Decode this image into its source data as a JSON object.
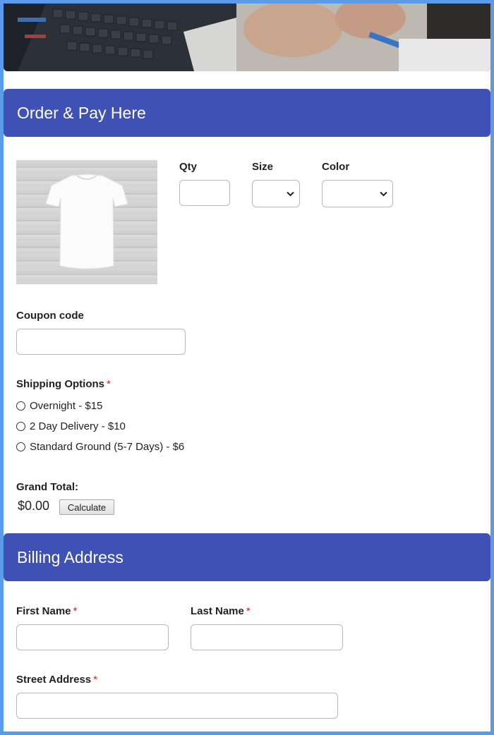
{
  "order_section": {
    "title": "Order & Pay Here",
    "qty_label": "Qty",
    "size_label": "Size",
    "color_label": "Color",
    "qty_value": "",
    "size_selected": "",
    "color_selected": "",
    "coupon_label": "Coupon code",
    "coupon_value": ""
  },
  "shipping": {
    "label": "Shipping Options",
    "required_mark": "*",
    "options": [
      {
        "label": "Overnight - $15",
        "selected": false
      },
      {
        "label": "2 Day Delivery - $10",
        "selected": false
      },
      {
        "label": "Standard Ground (5-7 Days) - $6",
        "selected": false
      }
    ]
  },
  "total": {
    "label": "Grand Total:",
    "value": "$0.00",
    "calculate_label": "Calculate"
  },
  "billing_section": {
    "title": "Billing Address",
    "first_name_label": "First Name",
    "last_name_label": "Last Name",
    "street_label": "Street Address",
    "required_mark": "*"
  },
  "colors": {
    "header_bg": "#3f51b5",
    "page_border": "#5b9bea",
    "required": "#d9231d"
  },
  "icons": {
    "hero": "laptop-and-hands-photo",
    "product": "white-tshirt-photo",
    "dropdown": "chevron-down-icon",
    "radio": "radio-icon"
  }
}
